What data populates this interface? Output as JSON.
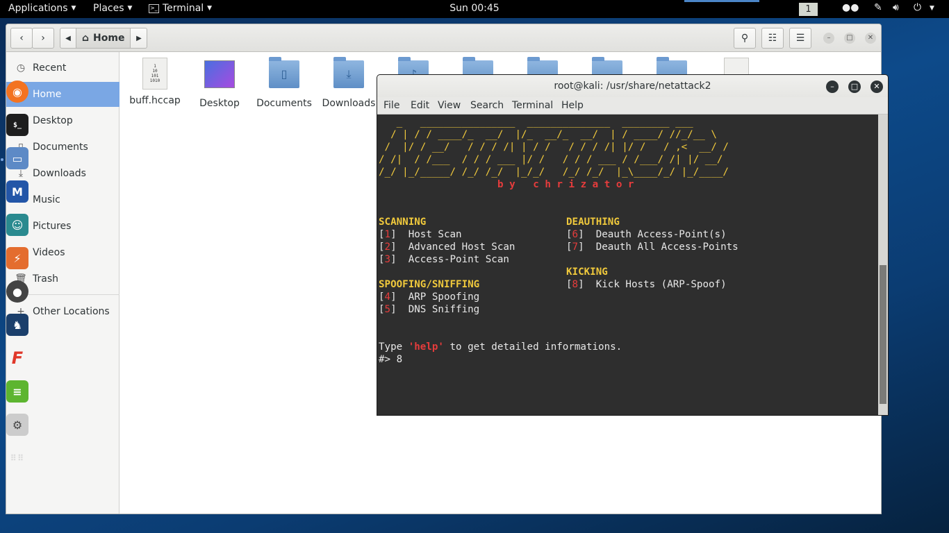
{
  "topbar": {
    "applications": "Applications",
    "places": "Places",
    "terminal": "Terminal",
    "clock": "Sun 00:45",
    "workspace": "1"
  },
  "files": {
    "path_home": "Home",
    "sidebar": [
      {
        "label": "Recent",
        "icon": "clock-icon"
      },
      {
        "label": "Home",
        "icon": "home-icon"
      },
      {
        "label": "Desktop",
        "icon": "desktop-icon"
      },
      {
        "label": "Documents",
        "icon": "document-icon"
      },
      {
        "label": "Downloads",
        "icon": "download-icon"
      },
      {
        "label": "Music",
        "icon": "music-icon"
      },
      {
        "label": "Pictures",
        "icon": "pictures-icon"
      },
      {
        "label": "Videos",
        "icon": "video-icon"
      },
      {
        "label": "Trash",
        "icon": "trash-icon"
      },
      {
        "label": "Other Locations",
        "icon": "plus-icon"
      }
    ],
    "items": [
      {
        "label": "buff.hccap"
      },
      {
        "label": "Desktop"
      },
      {
        "label": "Documents"
      },
      {
        "label": "Downloads"
      }
    ]
  },
  "terminal": {
    "title": "root@kali: /usr/share/netattack2",
    "menu": [
      "File",
      "Edit",
      "View",
      "Search",
      "Terminal",
      "Help"
    ],
    "banner": [
      "   _   ________________  ______________  ________ ___",
      "  / | / / ____/_  __/  |/_  __/_  __/  | / ____/ //_/__ \\",
      " /  |/ / __/   / / / /| | / /   / / / /| |/ /   / ,<  __/ /",
      "/ /|  / /___  / / / ___ |/ /   / / / ___ / /___/ /| |/ __/",
      "/_/ |_/_____/ /_/ /_/  |_/_/   /_/ /_/  |_\\____/_/ |_/____/"
    ],
    "byline": "b y   c h r i z a t o r",
    "sections": {
      "scanning": "SCANNING",
      "deauthing": "DEAUTHING",
      "kicking": "KICKING",
      "spoofing": "SPOOFING/SNIFFING"
    },
    "options": [
      {
        "num": "1",
        "label": "Host Scan"
      },
      {
        "num": "2",
        "label": "Advanced Host Scan"
      },
      {
        "num": "3",
        "label": "Access-Point Scan"
      },
      {
        "num": "4",
        "label": "ARP Spoofing"
      },
      {
        "num": "5",
        "label": "DNS Sniffing"
      },
      {
        "num": "6",
        "label": "Deauth Access-Point(s)"
      },
      {
        "num": "7",
        "label": "Deauth All Access-Points"
      },
      {
        "num": "8",
        "label": "Kick Hosts (ARP-Spoof)"
      }
    ],
    "help_prefix": "Type ",
    "help_word": "'help'",
    "help_suffix": " to get detailed informations.",
    "prompt": "#>",
    "input": " 8"
  },
  "colors": {
    "accent": "#7aa7e4",
    "banner_yellow": "#f0c93c",
    "banner_red": "#e63c3c"
  }
}
